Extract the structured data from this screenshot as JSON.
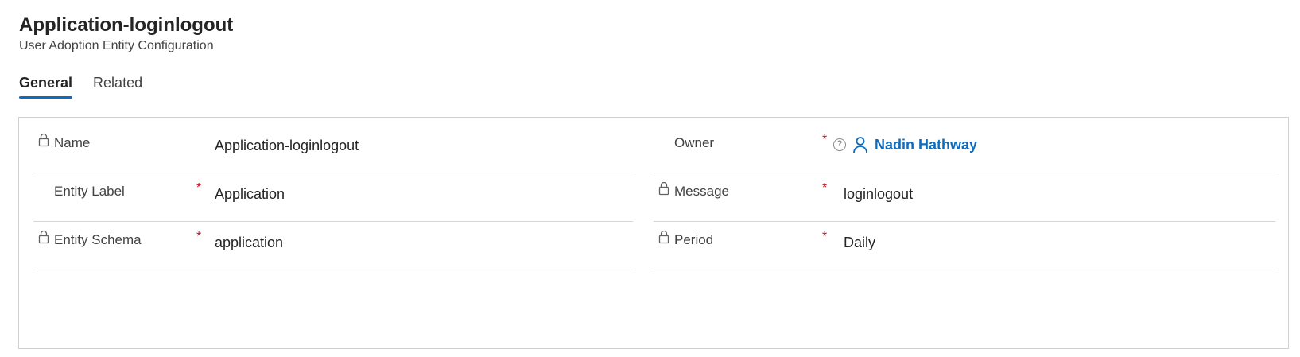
{
  "header": {
    "title": "Application-loginlogout",
    "subtitle": "User Adoption Entity Configuration"
  },
  "tabs": [
    {
      "label": "General",
      "active": true
    },
    {
      "label": "Related",
      "active": false
    }
  ],
  "form": {
    "left": [
      {
        "label": "Name",
        "locked": true,
        "required": false,
        "value": "Application-loginlogout"
      },
      {
        "label": "Entity Label",
        "locked": false,
        "required": true,
        "value": "Application"
      },
      {
        "label": "Entity Schema",
        "locked": true,
        "required": true,
        "value": "application"
      }
    ],
    "right": [
      {
        "label": "Owner",
        "locked": false,
        "required": true,
        "value": "Nadin Hathway"
      },
      {
        "label": "Message",
        "locked": true,
        "required": true,
        "value": "loginlogout"
      },
      {
        "label": "Period",
        "locked": true,
        "required": true,
        "value": "Daily"
      }
    ],
    "required_marker": "*",
    "help_glyph": "?"
  },
  "icons": {
    "lock": "lock-icon",
    "help": "help-icon",
    "owner": "person-icon"
  },
  "colors": {
    "accent": "#0f6cbd",
    "required": "#c50f1f",
    "border": "#d1d1d1"
  }
}
